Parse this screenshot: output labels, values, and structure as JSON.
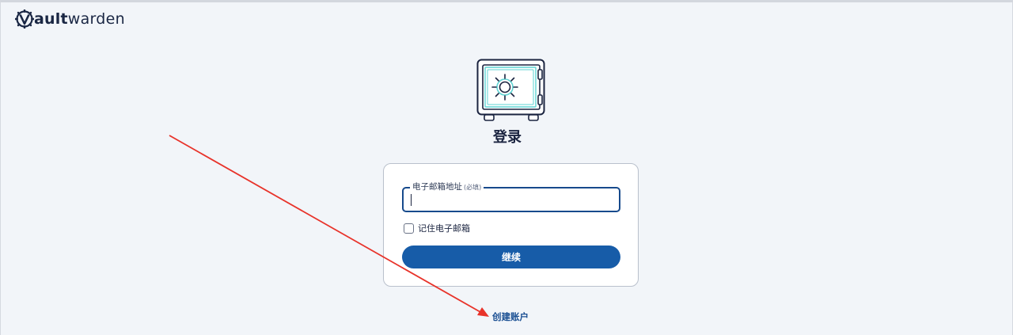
{
  "brand": {
    "name_bold": "ault",
    "name_light": "warden",
    "logo_icon": "vaultwarden-gear-v-icon"
  },
  "hero": {
    "icon": "vault-safe-icon",
    "title": "登录"
  },
  "login_form": {
    "email_label": "电子邮箱地址",
    "email_required": "(必填)",
    "email_value": "",
    "remember_label": "记住电子邮箱",
    "remember_checked": false,
    "continue_label": "继续"
  },
  "create_account_label": "创建账户",
  "colors": {
    "page_bg": "#f2f5f9",
    "primary": "#175ca8",
    "field_border": "#174a8c",
    "annotation_arrow": "#e8332a"
  }
}
